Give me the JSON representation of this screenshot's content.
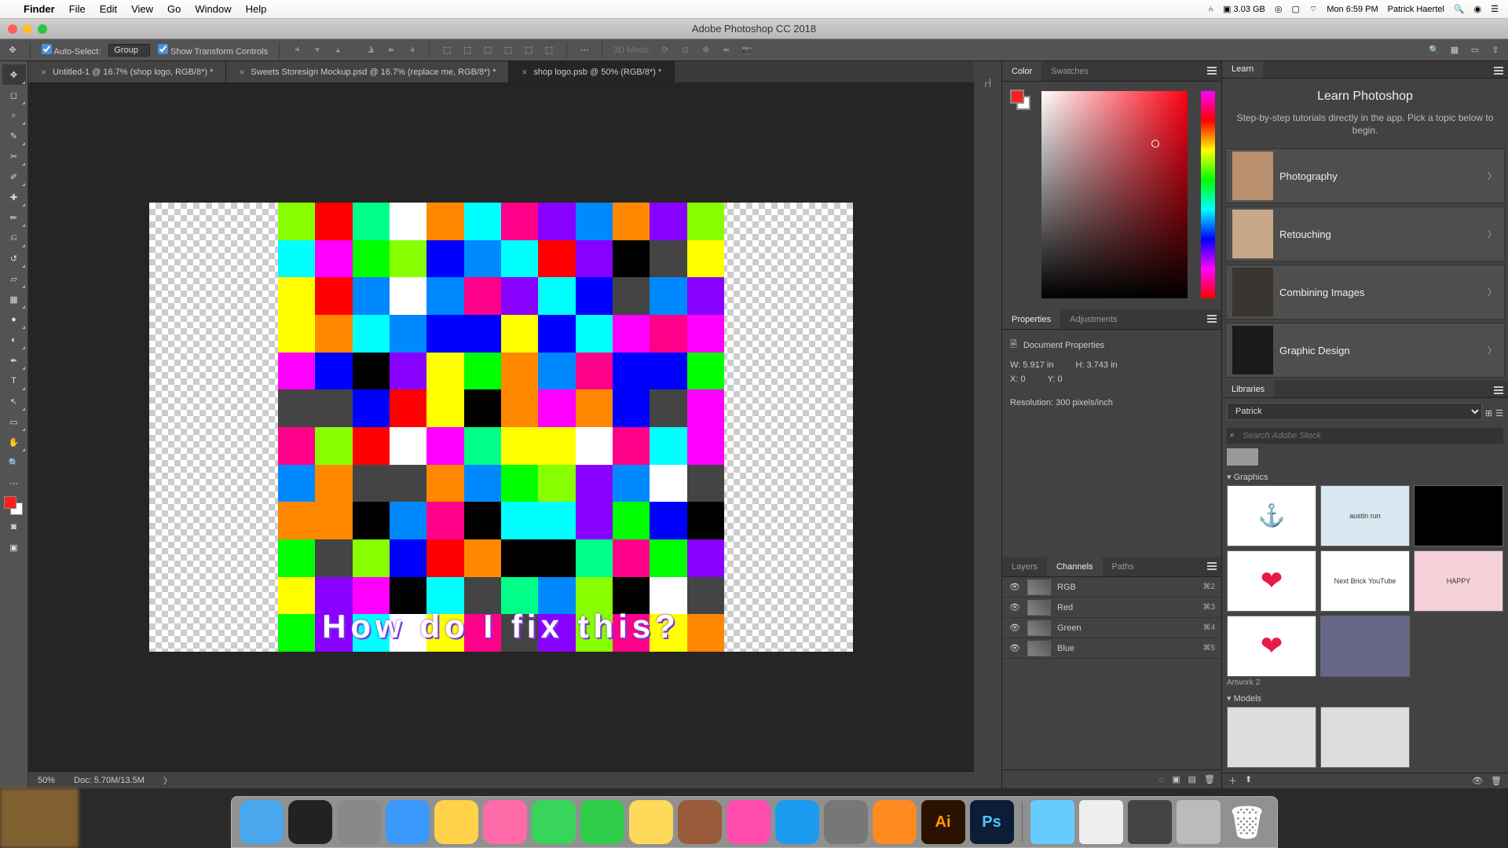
{
  "menubar": {
    "app": "Finder",
    "items": [
      "File",
      "Edit",
      "View",
      "Go",
      "Window",
      "Help"
    ],
    "status": {
      "storage": "3.03 GB",
      "datetime": "Mon 6:59 PM",
      "user": "Patrick Haertel"
    }
  },
  "window": {
    "title": "Adobe Photoshop CC 2018"
  },
  "options": {
    "autoSelect": "Auto-Select:",
    "autoSelectValue": "Group",
    "showTransform": "Show Transform Controls",
    "threeDMode": "3D Mode:"
  },
  "tabs": [
    {
      "label": "Untitled-1 @ 16.7% (shop logo, RGB/8*) *",
      "active": false
    },
    {
      "label": "Sweets Storesign Mockup.psd @ 16.7% (replace me, RGB/8*) *",
      "active": false
    },
    {
      "label": "shop logo.psb @ 50% (RGB/8*) *",
      "active": true
    }
  ],
  "canvas": {
    "overlayText": "How do I fix this?"
  },
  "statusbar": {
    "zoom": "50%",
    "doc": "Doc: 5.70M/13.5M"
  },
  "colorPanel": {
    "tabs": [
      "Color",
      "Swatches"
    ]
  },
  "propertiesPanel": {
    "tabs": [
      "Properties",
      "Adjustments"
    ],
    "header": "Document Properties",
    "w": "W: 5.917 in",
    "h": "H: 3.743 in",
    "x": "X: 0",
    "y": "Y: 0",
    "resolution": "Resolution: 300 pixels/inch"
  },
  "channelsPanel": {
    "tabs": [
      "Layers",
      "Channels",
      "Paths"
    ],
    "channels": [
      {
        "name": "RGB",
        "shortcut": "⌘2"
      },
      {
        "name": "Red",
        "shortcut": "⌘3"
      },
      {
        "name": "Green",
        "shortcut": "⌘4"
      },
      {
        "name": "Blue",
        "shortcut": "⌘5"
      }
    ]
  },
  "learnPanel": {
    "tab": "Learn",
    "title": "Learn Photoshop",
    "subtitle": "Step-by-step tutorials directly in the app. Pick a topic below to begin.",
    "topics": [
      "Photography",
      "Retouching",
      "Combining Images",
      "Graphic Design"
    ]
  },
  "librariesPanel": {
    "tab": "Libraries",
    "selected": "Patrick",
    "searchPlaceholder": "Search Adobe Stock",
    "graphicsHeader": "Graphics",
    "modelsHeader": "Models",
    "firstLabel": "Artwork 2",
    "graphics": [
      "",
      "austin run",
      "",
      "❤",
      "Next Brick YouTube",
      "HAPPY",
      "❤",
      ""
    ]
  },
  "dock": [
    "Finder",
    "Siri",
    "Launchpad",
    "Safari",
    "Mail",
    "Photos",
    "Messages",
    "FaceTime",
    "Notes",
    "Dictionary",
    "iTunes",
    "App Store",
    "Sys Prefs",
    "Blender",
    "Ai",
    "Ps"
  ]
}
